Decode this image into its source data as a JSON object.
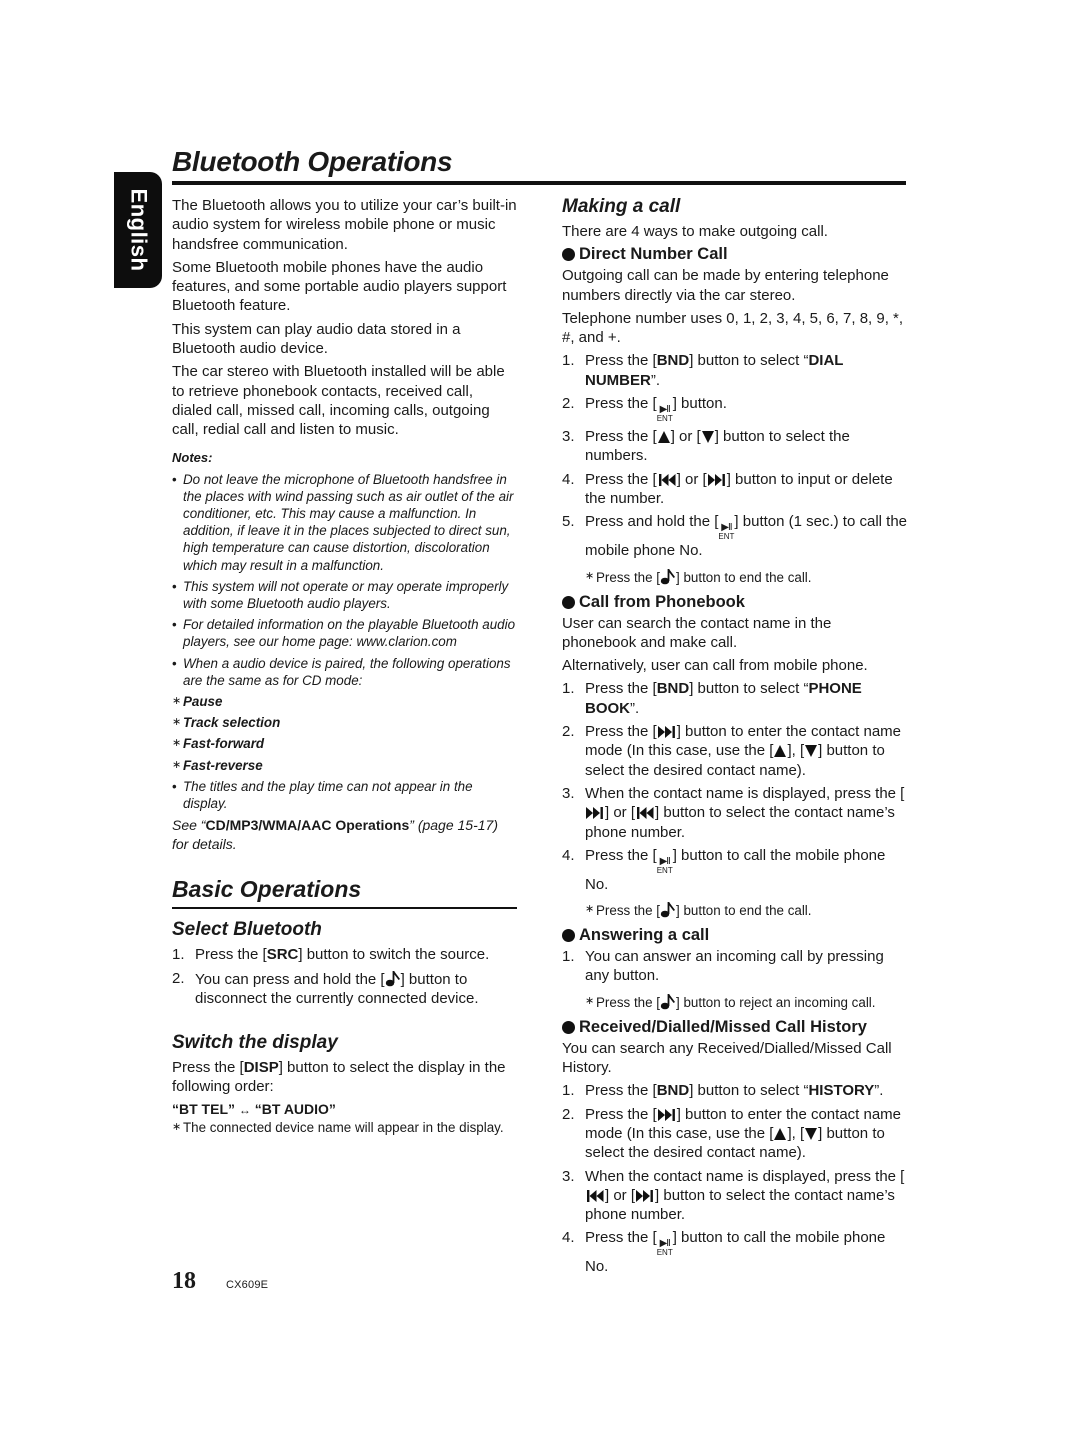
{
  "header": {
    "title": "Bluetooth Operations",
    "language_tab": "English"
  },
  "left": {
    "intro": [
      "The Bluetooth allows you to utilize your car’s built-in audio system for wireless mobile phone or music handsfree communication.",
      "Some Bluetooth mobile phones have the audio features, and some portable audio players support Bluetooth feature.",
      "This system can play audio data stored in a Bluetooth audio device.",
      "The car stereo with Bluetooth installed will be able to retrieve phonebook contacts, received call, dialed call, missed call, incoming calls, outgoing call, redial call and listen to music."
    ],
    "notes_label": "Notes:",
    "notes": [
      "Do not leave the microphone of Bluetooth handsfree in the places with wind passing such as air outlet of the air conditioner, etc. This may cause a malfunction. In addition, if leave it in the places subjected to direct sun, high temperature can cause distortion, discoloration which may result in a malfunction.",
      "This system will not operate or may operate improperly with some Bluetooth audio players.",
      "For detailed information on the playable Bluetooth audio players, see our home page: www.clarion.com",
      "When a audio device is paired, the following operations are the same as for CD mode:"
    ],
    "cd_ops": [
      "Pause",
      "Track selection",
      "Fast-forward",
      "Fast-reverse"
    ],
    "note_last": "The titles and the play time can not appear in the display.",
    "see": {
      "prefix": "See “",
      "ref": "CD/MP3/WMA/AAC Operations",
      "suffix": "” (page 15-17) for details."
    },
    "basic": {
      "title": "Basic Operations",
      "select_bt": {
        "title": "Select Bluetooth",
        "step1": {
          "num": "1.",
          "a": "Press the [",
          "key": "SRC",
          "b": "] button to switch the source."
        },
        "step2": {
          "num": "2.",
          "a": "You can press and hold the [",
          "b": "] button to disconnect the currently connected device."
        }
      },
      "switch_display": {
        "title": "Switch the display",
        "text_a": "Press the [",
        "key": "DISP",
        "text_b": "] button to select the display in the following order:",
        "order_a": "“BT TEL”",
        "order_arrow": "↔",
        "order_b": "“BT AUDIO”",
        "note": "The connected device name will appear in the display."
      }
    }
  },
  "right": {
    "making_call": {
      "title": "Making a call",
      "intro": "There are 4 ways to make outgoing call."
    },
    "direct": {
      "title": "Direct Number Call",
      "p1": "Outgoing call can be made by entering telephone numbers directly via the car stereo.",
      "p2": "Telephone number uses 0, 1, 2, 3, 4, 5, 6, 7, 8, 9, *, #, and +.",
      "s1": {
        "num": "1.",
        "a": "Press the [",
        "key": "BND",
        "b": "] button to select “",
        "sel": "DIAL NUMBER",
        "c": "”."
      },
      "s2": {
        "num": "2.",
        "a": "Press the [",
        "b": "] button."
      },
      "s3": {
        "num": "3.",
        "a": "Press the [",
        "b": "] or [",
        "c": "] button to select the numbers."
      },
      "s4": {
        "num": "4.",
        "a": "Press the [",
        "b": "] or [",
        "c": "] button to input or delete the number."
      },
      "s5": {
        "num": "5.",
        "a": "Press and hold the [",
        "b": "] button (1 sec.) to call the mobile phone No."
      },
      "note_a": "Press the [",
      "note_b": "] button to end the call."
    },
    "phonebook": {
      "title": "Call from Phonebook",
      "p1": "User can search the contact name in the phonebook and make call.",
      "p2": "Alternatively, user can call from mobile phone.",
      "s1": {
        "num": "1.",
        "a": "Press the [",
        "key": "BND",
        "b": "] button to select “",
        "sel": "PHONE BOOK",
        "c": "”."
      },
      "s2": {
        "num": "2.",
        "a": "Press the [",
        "b": "] button to enter the contact name mode (In this case, use the  [",
        "c": "], [",
        "d": "] button to select the desired contact name)."
      },
      "s3": {
        "num": "3.",
        "a": "When the contact name is displayed, press the [",
        "b": "] or [",
        "c": "] button to select the contact name’s phone number."
      },
      "s4": {
        "num": "4.",
        "a": "Press the [",
        "b": "] button to call the mobile phone No."
      },
      "note_a": "Press the [",
      "note_b": "] button to end the call."
    },
    "answering": {
      "title": "Answering a call",
      "s1": {
        "num": "1.",
        "text": "You can answer an incoming call by pressing any button."
      },
      "note_a": "Press the [",
      "note_b": "] button to reject an incoming call."
    },
    "history": {
      "title": "Received/Dialled/Missed Call History",
      "p1": "You can search any Received/Dialled/Missed Call History.",
      "s1": {
        "num": "1.",
        "a": "Press the [",
        "key": "BND",
        "b": "] button to select “",
        "sel": "HISTORY",
        "c": "”."
      },
      "s2": {
        "num": "2.",
        "a": "Press the [",
        "b": "] button to enter the contact name mode (In this case, use the [",
        "c": "], [",
        "d": "] button to select the desired contact name)."
      },
      "s3": {
        "num": "3.",
        "a": "When the contact name is displayed, press the [",
        "b": "] or [",
        "c": "] button to select the contact name’s phone number."
      },
      "s4": {
        "num": "4.",
        "a": "Press the [",
        "b": "] button to call the mobile phone No."
      }
    }
  },
  "icons": {
    "bullet": "•",
    "asterisk": "∗",
    "ent_top": "▶II",
    "ent_bottom": "ENT"
  },
  "footer": {
    "page_number": "18",
    "model": "CX609E"
  }
}
